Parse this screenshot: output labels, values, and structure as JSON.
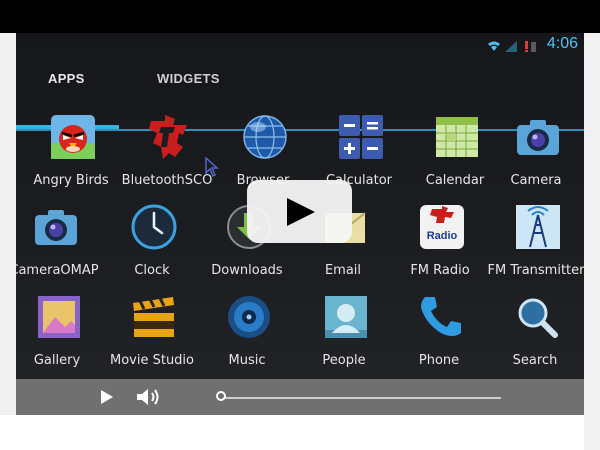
{
  "status": {
    "time": "4:06",
    "accent": "#33b5e5"
  },
  "tabs": [
    {
      "label": "APPS",
      "selected": true
    },
    {
      "label": "WIDGETS",
      "selected": false
    }
  ],
  "apps": [
    {
      "label": "Angry Birds",
      "icon": "angry-birds-icon"
    },
    {
      "label": "BluetoothSCO",
      "icon": "bluetooth-sco-icon"
    },
    {
      "label": "Browser",
      "icon": "browser-globe-icon"
    },
    {
      "label": "Calculator",
      "icon": "calculator-icon"
    },
    {
      "label": "Calendar",
      "icon": "calendar-icon"
    },
    {
      "label": "Camera",
      "icon": "camera-icon"
    },
    {
      "label": "CameraOMAP",
      "icon": "camera-omap-icon"
    },
    {
      "label": "Clock",
      "icon": "clock-icon"
    },
    {
      "label": "Downloads",
      "icon": "downloads-icon"
    },
    {
      "label": "Email",
      "icon": "email-icon"
    },
    {
      "label": "FM Radio",
      "icon": "fm-radio-icon"
    },
    {
      "label": "FM Transmitter",
      "icon": "fm-transmitter-icon"
    },
    {
      "label": "Gallery",
      "icon": "gallery-icon"
    },
    {
      "label": "Movie Studio",
      "icon": "movie-studio-icon"
    },
    {
      "label": "Music",
      "icon": "music-icon"
    },
    {
      "label": "People",
      "icon": "people-icon"
    },
    {
      "label": "Phone",
      "icon": "phone-icon"
    },
    {
      "label": "Search",
      "icon": "search-icon"
    }
  ],
  "player": {
    "progress": 0
  }
}
